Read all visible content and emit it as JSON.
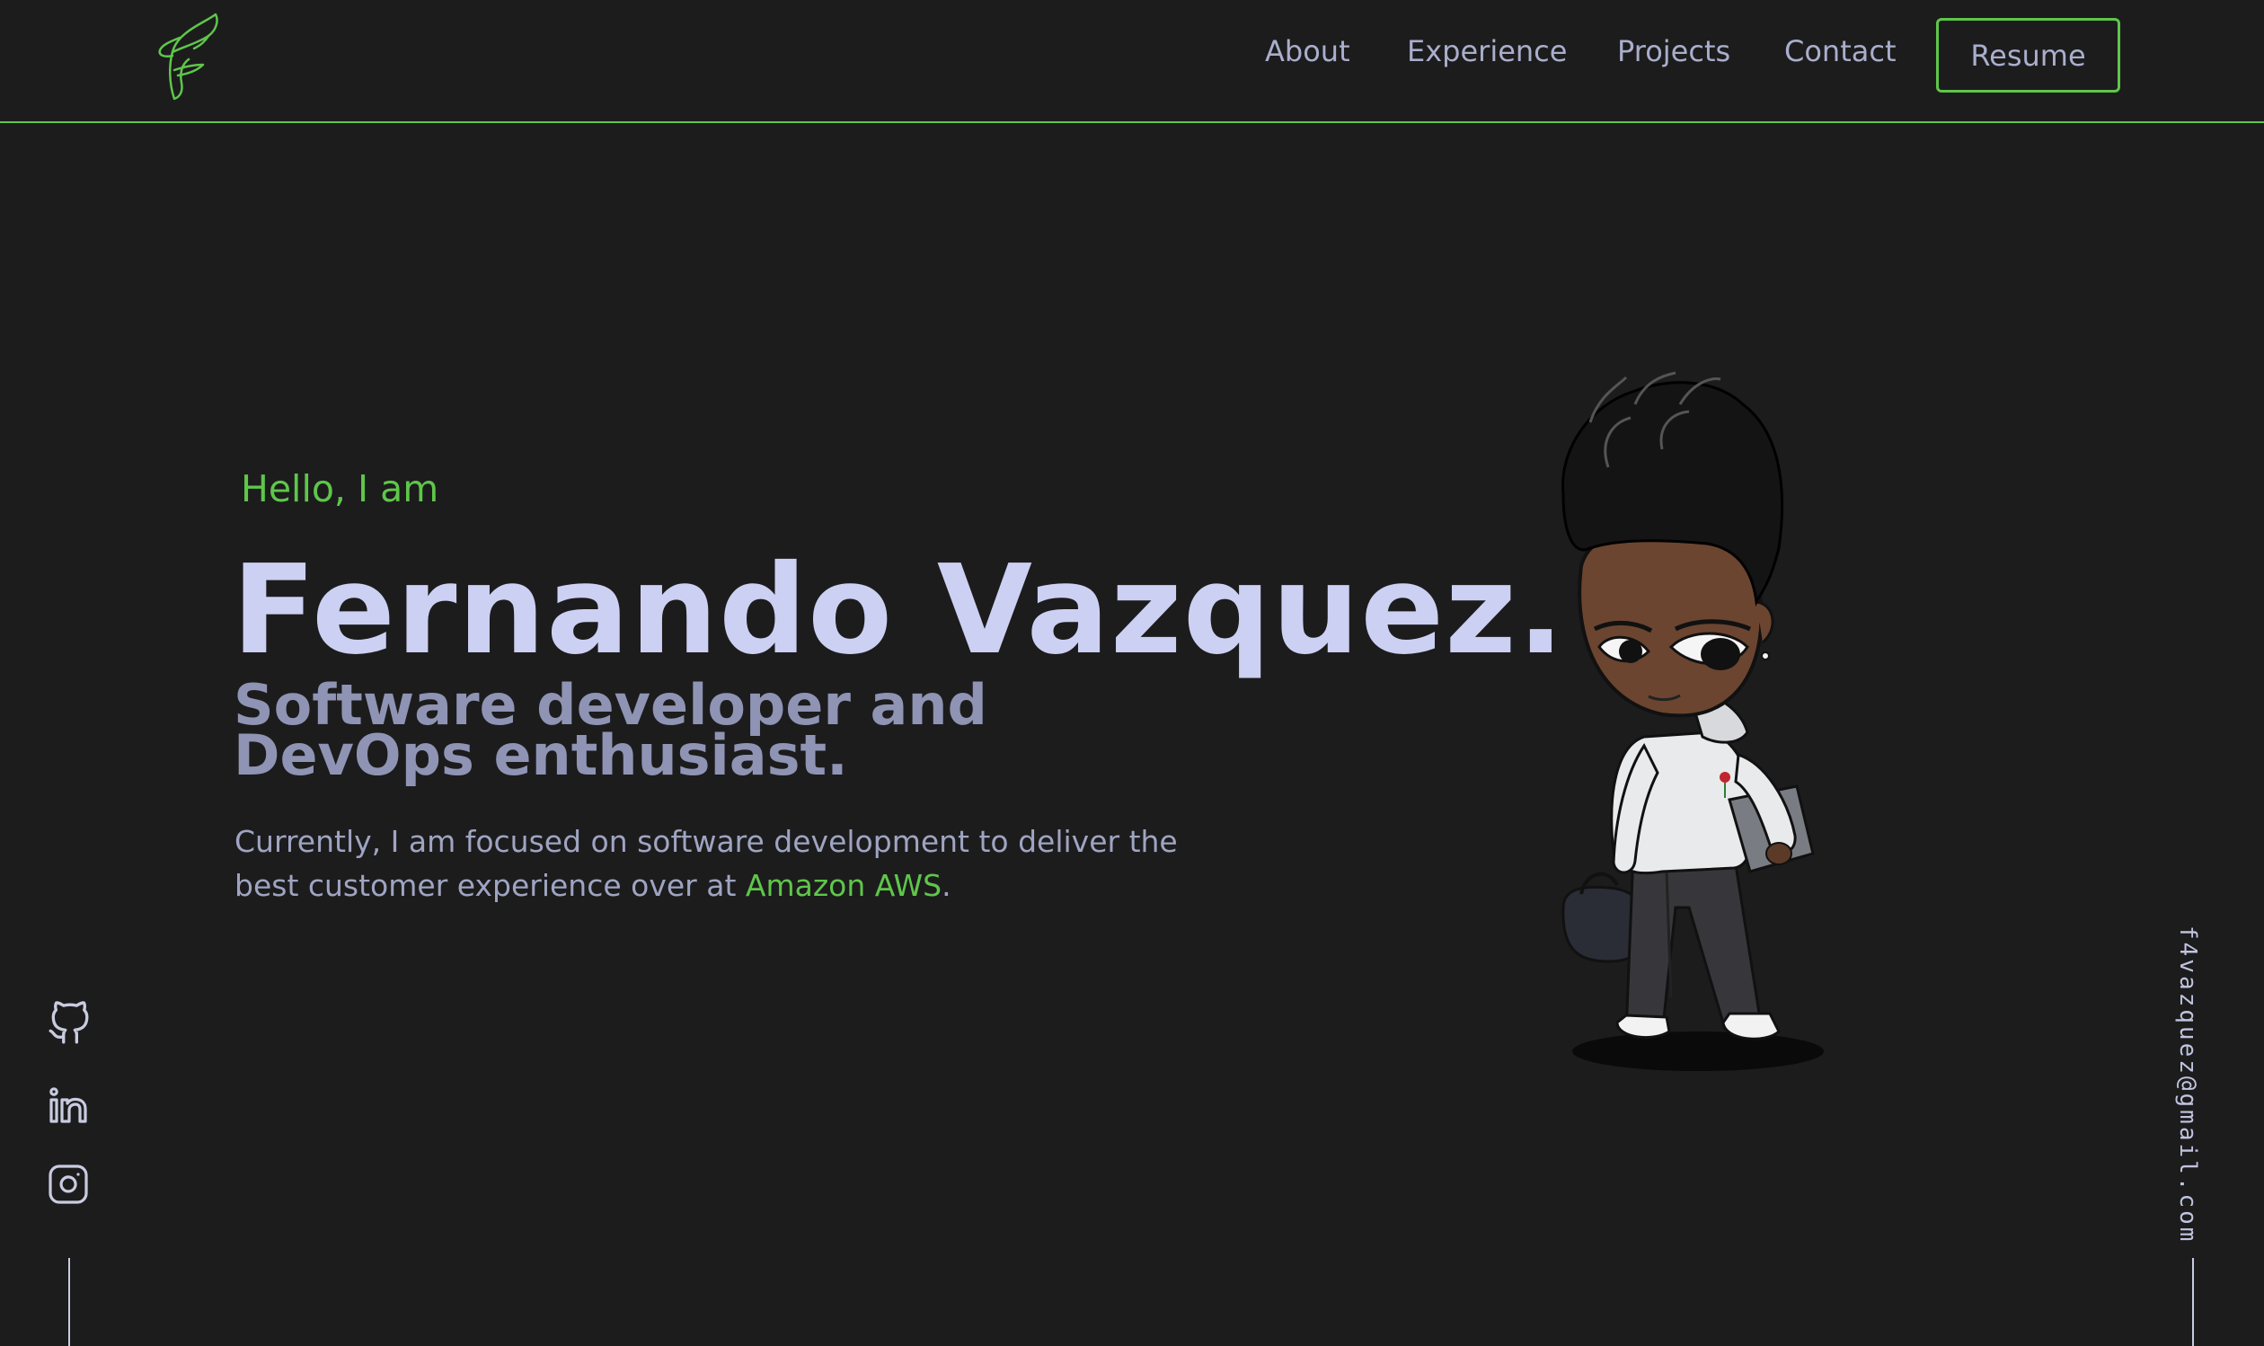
{
  "nav": {
    "items": [
      {
        "label": "About"
      },
      {
        "label": "Experience"
      },
      {
        "label": "Projects"
      },
      {
        "label": "Contact"
      }
    ],
    "resume_label": "Resume"
  },
  "hero": {
    "greeting": "Hello, I am",
    "name": "Fernando Vazquez.",
    "subtitle": "Software developer and DevOps enthusiast.",
    "description_prefix": "Currently, I am focused on software development to deliver the best customer experience over at ",
    "description_link": "Amazon AWS",
    "description_suffix": "."
  },
  "social": {
    "icons": [
      "github-icon",
      "linkedin-icon",
      "instagram-icon"
    ]
  },
  "email": "f4vazquez@gmail.com",
  "colors": {
    "background": "#1c1c1d",
    "accent": "#5fc64a",
    "heading": "#ccd0f2",
    "muted": "#8f94b4"
  }
}
